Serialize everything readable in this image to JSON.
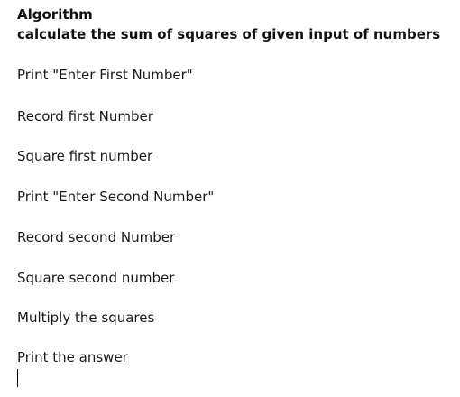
{
  "document": {
    "title": "Algorithm",
    "subtitle": "calculate the sum of squares of given input of numbers",
    "steps": [
      "Print \"Enter First Number\"",
      "Record first Number",
      "Square first number",
      "Print \"Enter Second Number\"",
      "Record second Number",
      "Square second number",
      "Multiply the squares",
      "Print the answer"
    ]
  }
}
